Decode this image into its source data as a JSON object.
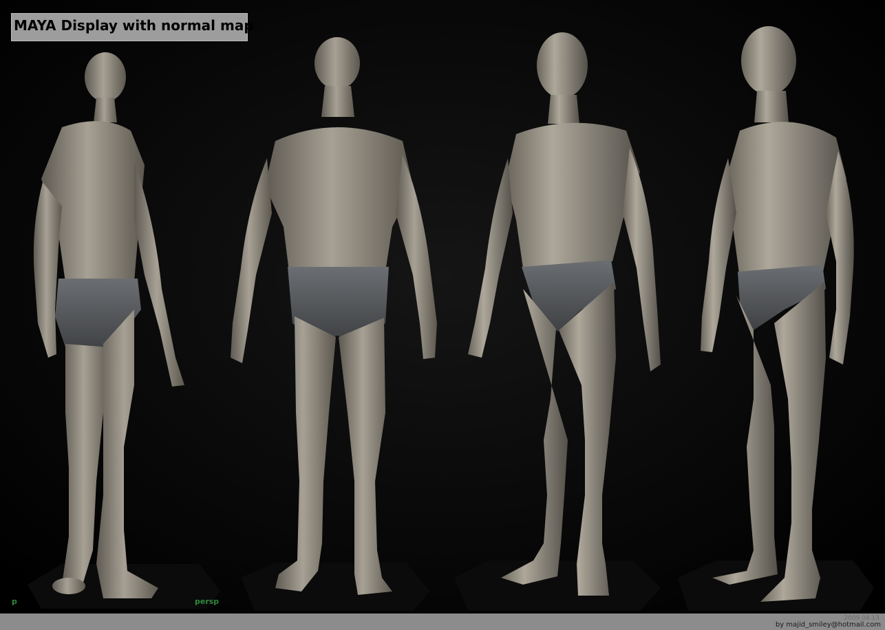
{
  "title": "MAYA Display with normal map",
  "viewports": [
    {
      "camera_label": "p",
      "view": "back three-quarter"
    },
    {
      "camera_label": "persp",
      "view": "back"
    },
    {
      "camera_label": "",
      "view": "front three-quarter left"
    },
    {
      "camera_label": "",
      "view": "front three-quarter right"
    }
  ],
  "footer": {
    "date": "2009.04.13",
    "credit": "by majid_smiley@hotmail.com"
  },
  "colors": {
    "background": "#000000",
    "skin": "#9b958a",
    "briefs": "#5c5e61",
    "title_bg": "#9d9d9d",
    "footer_bg": "#8c8c8c",
    "camera_label": "#2f8a3a"
  }
}
